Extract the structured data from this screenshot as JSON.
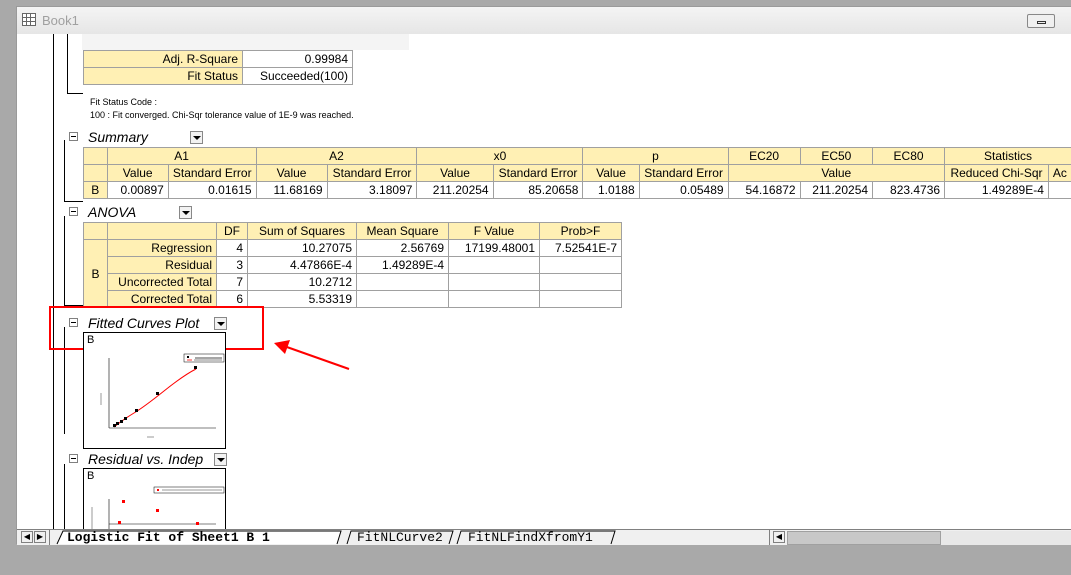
{
  "window": {
    "title": "Book1"
  },
  "fit_stats": {
    "rows": [
      {
        "label": "Adj. R-Square",
        "value": "0.99984"
      },
      {
        "label": "Fit Status",
        "value": "Succeeded(100)"
      }
    ]
  },
  "fit_status": {
    "title": "Fit Status Code :",
    "message": "100 : Fit converged. Chi-Sqr tolerance value of 1E-9 was reached."
  },
  "summary": {
    "title": "Summary",
    "groups": [
      "A1",
      "A2",
      "x0",
      "p",
      "EC20",
      "EC50",
      "EC80",
      "Statistics"
    ],
    "subheaders": [
      "Value",
      "Standard Error",
      "Value",
      "Standard Error",
      "Value",
      "Standard Error",
      "Value",
      "Standard Error",
      "Value",
      "Reduced Chi-Sqr",
      "Ac"
    ],
    "row_label": "B",
    "values": [
      "0.00897",
      "0.01615",
      "11.68169",
      "3.18097",
      "211.20254",
      "85.20658",
      "1.0188",
      "0.05489",
      "54.16872",
      "211.20254",
      "823.4736",
      "1.49289E-4"
    ]
  },
  "anova": {
    "title": "ANOVA",
    "headers": [
      "DF",
      "Sum of Squares",
      "Mean Square",
      "F Value",
      "Prob>F"
    ],
    "row_group": "B",
    "rows": [
      {
        "label": "Regression",
        "df": "4",
        "ss": "10.27075",
        "ms": "2.56769",
        "f": "17199.48001",
        "p": "7.52541E-7"
      },
      {
        "label": "Residual",
        "df": "3",
        "ss": "4.47866E-4",
        "ms": "1.49289E-4",
        "f": "",
        "p": ""
      },
      {
        "label": "Uncorrected Total",
        "df": "7",
        "ss": "10.2712",
        "ms": "",
        "f": "",
        "p": ""
      },
      {
        "label": "Corrected Total",
        "df": "6",
        "ss": "5.53319",
        "ms": "",
        "f": "",
        "p": ""
      }
    ]
  },
  "fitted_curves": {
    "title": "Fitted Curves Plot",
    "graph_label": "B"
  },
  "residual": {
    "title": "Residual vs. Indep",
    "graph_label": "B"
  },
  "sheet_tabs": [
    {
      "label": "Logistic Fit of Sheet1 B 1",
      "active": true
    },
    {
      "label": "FitNLCurve2",
      "active": false
    },
    {
      "label": "FitNLFindXfromY1",
      "active": false
    }
  ],
  "colors": {
    "header_bg": "#fff0b4",
    "highlight": "#ff0000"
  },
  "icons": [
    "spreadsheet-icon",
    "minimize-icon",
    "collapse-icon",
    "dropdown-icon",
    "arrow-icon"
  ]
}
